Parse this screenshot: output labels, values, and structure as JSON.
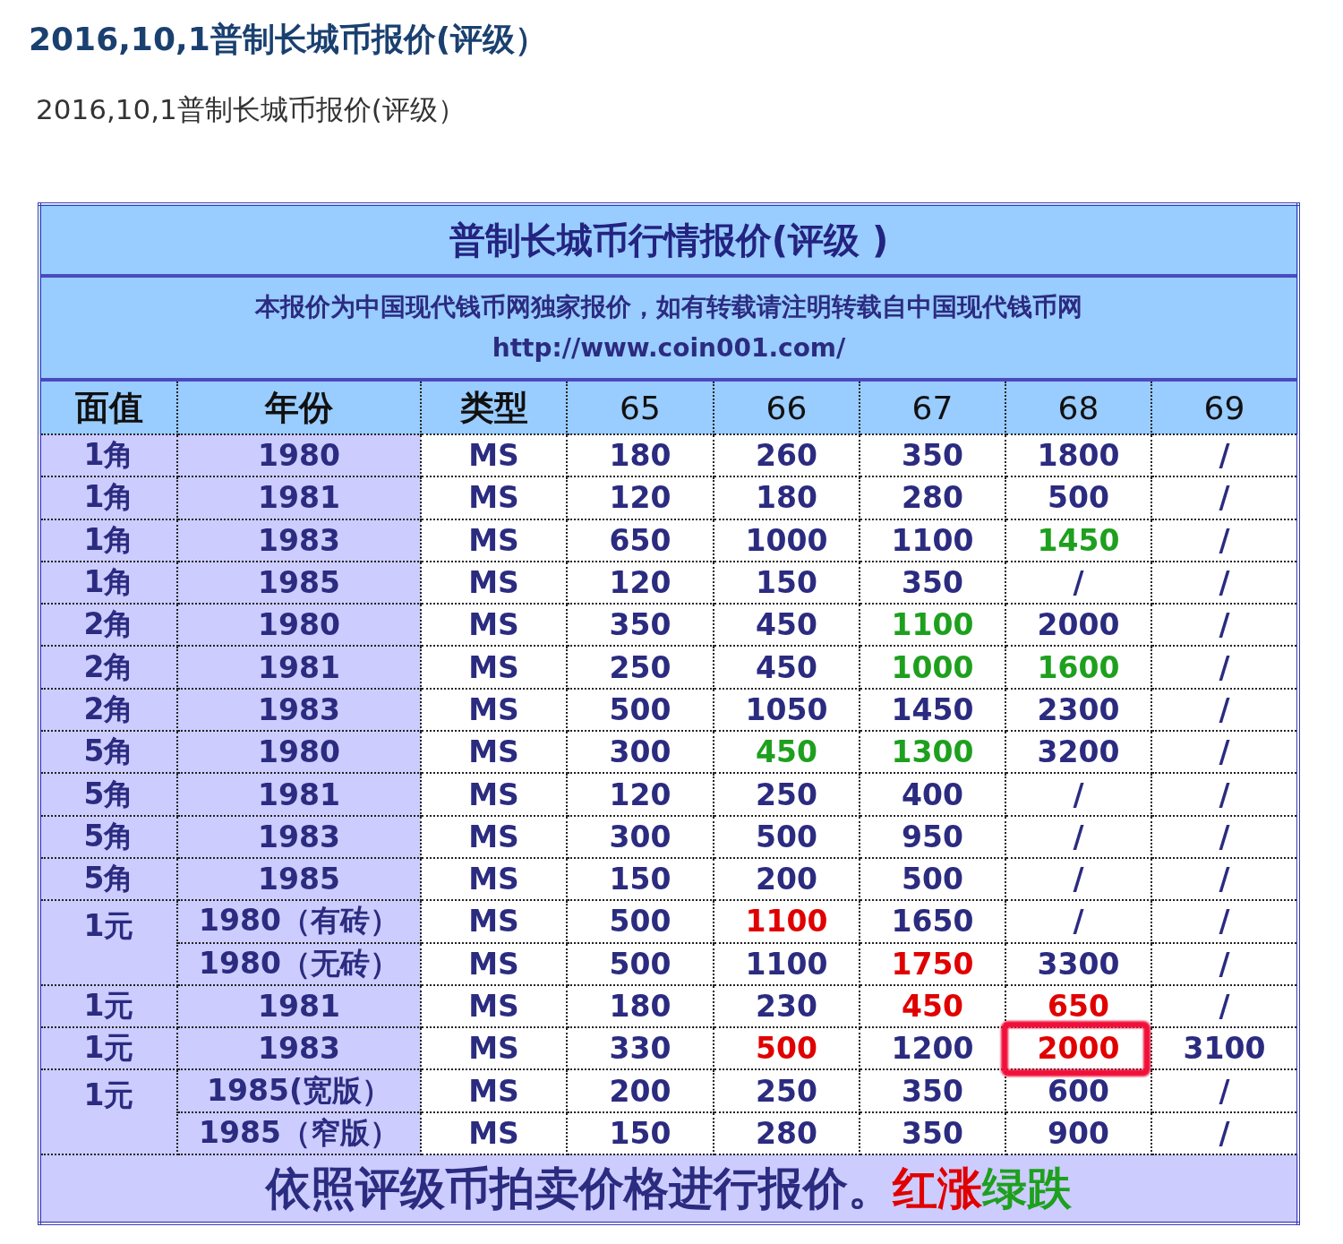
{
  "article": {
    "title": "2016,10,1普制长城币报价(评级）",
    "subtitle": "2016,10,1普制长城币报价(评级）"
  },
  "table": {
    "title": "普制长城币行情报价(评级 )",
    "notice": "本报价为中国现代钱币网独家报价，如有转载请注明转载自中国现代钱币网",
    "url": "http://www.coin001.com/",
    "columns": [
      "面值",
      "年份",
      "类型",
      "65",
      "66",
      "67",
      "68",
      "69"
    ],
    "groups": [
      {
        "denomination": "1角",
        "rows": [
          {
            "year": "1980",
            "type": "MS",
            "prices": [
              "180",
              "260",
              "350",
              "1800",
              "/"
            ]
          }
        ]
      },
      {
        "denomination": "1角",
        "rows": [
          {
            "year": "1981",
            "type": "MS",
            "prices": [
              "120",
              "180",
              "280",
              "500",
              "/"
            ]
          }
        ]
      },
      {
        "denomination": "1角",
        "rows": [
          {
            "year": "1983",
            "type": "MS",
            "prices": [
              "650",
              "1000",
              "1100",
              {
                "text": "1450",
                "color": "#1ea01e"
              },
              "/"
            ]
          }
        ]
      },
      {
        "denomination": "1角",
        "rows": [
          {
            "year": "1985",
            "type": "MS",
            "prices": [
              "120",
              "150",
              "350",
              "/",
              "/"
            ]
          }
        ]
      },
      {
        "denomination": "2角",
        "rows": [
          {
            "year": "1980",
            "type": "MS",
            "prices": [
              "350",
              "450",
              {
                "text": "1100",
                "color": "#1ea01e"
              },
              "2000",
              "/"
            ]
          }
        ]
      },
      {
        "denomination": "2角",
        "rows": [
          {
            "year": "1981",
            "type": "MS",
            "prices": [
              "250",
              "450",
              {
                "text": "1000",
                "color": "#1ea01e"
              },
              {
                "text": "1600",
                "color": "#1ea01e"
              },
              "/"
            ]
          }
        ]
      },
      {
        "denomination": "2角",
        "rows": [
          {
            "year": "1983",
            "type": "MS",
            "prices": [
              "500",
              "1050",
              "1450",
              "2300",
              "/"
            ]
          }
        ]
      },
      {
        "denomination": "5角",
        "rows": [
          {
            "year": "1980",
            "type": "MS",
            "prices": [
              "300",
              {
                "text": "450",
                "color": "#1ea01e"
              },
              {
                "text": "1300",
                "color": "#1ea01e"
              },
              "3200",
              "/"
            ]
          }
        ]
      },
      {
        "denomination": "5角",
        "rows": [
          {
            "year": "1981",
            "type": "MS",
            "prices": [
              "120",
              "250",
              "400",
              "/",
              "/"
            ]
          }
        ]
      },
      {
        "denomination": "5角",
        "rows": [
          {
            "year": "1983",
            "type": "MS",
            "prices": [
              "300",
              "500",
              "950",
              "/",
              "/"
            ]
          }
        ]
      },
      {
        "denomination": "5角",
        "rows": [
          {
            "year": "1985",
            "type": "MS",
            "prices": [
              "150",
              "200",
              "500",
              "/",
              "/"
            ]
          }
        ]
      },
      {
        "denomination": "1元",
        "rows": [
          {
            "year": "1980（有砖）",
            "type": "MS",
            "prices": [
              "500",
              {
                "text": "1100",
                "color": "#e00000"
              },
              "1650",
              "/",
              "/"
            ]
          },
          {
            "year": "1980（无砖）",
            "type": "MS",
            "prices": [
              "500",
              "1100",
              {
                "text": "1750",
                "color": "#e00000"
              },
              "3300",
              "/"
            ]
          }
        ]
      },
      {
        "denomination": "1元",
        "rows": [
          {
            "year": "1981",
            "type": "MS",
            "prices": [
              "180",
              "230",
              {
                "text": "450",
                "color": "#e00000"
              },
              {
                "text": "650",
                "color": "#e00000"
              },
              "/"
            ]
          }
        ]
      },
      {
        "denomination": "1元",
        "rows": [
          {
            "year": "1983",
            "type": "MS",
            "prices": [
              "330",
              {
                "text": "500",
                "color": "#e00000"
              },
              "1200",
              {
                "text": "2000",
                "color": "#e00000",
                "circled": true
              },
              "3100"
            ]
          }
        ]
      },
      {
        "denomination": "1元",
        "rows": [
          {
            "year": "1985(宽版）",
            "type": "MS",
            "prices": [
              "200",
              "250",
              "350",
              "600",
              "/"
            ]
          },
          {
            "year": "1985（窄版）",
            "type": "MS",
            "prices": [
              "150",
              "280",
              "350",
              "900",
              "/"
            ]
          }
        ]
      }
    ],
    "footer": {
      "note": "依照评级币拍卖价格进行报价。",
      "legend": [
        {
          "text": "红涨",
          "color": "#e00000"
        },
        {
          "text": "绿跌",
          "color": "#1ea01e"
        }
      ]
    }
  }
}
